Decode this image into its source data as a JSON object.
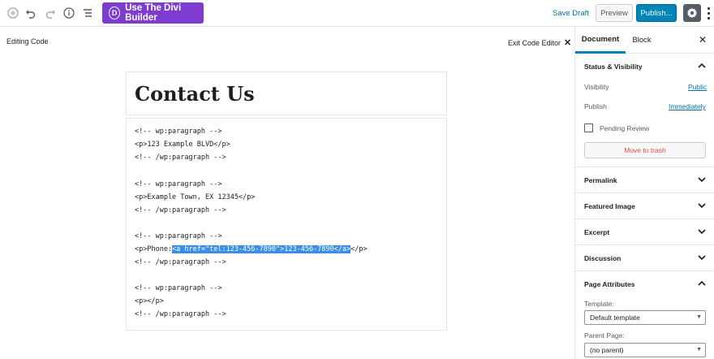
{
  "toolbar": {
    "divi_label": "Use The Divi Builder",
    "divi_logo": "D",
    "save_draft": "Save Draft",
    "preview": "Preview",
    "publish": "Publish..."
  },
  "editor": {
    "mode_label": "Editing Code",
    "exit_label": "Exit Code Editor",
    "title": "Contact Us",
    "code_lines": [
      "<!-- wp:paragraph -->",
      "<p>123 Example BLVD</p>",
      "<!-- /wp:paragraph -->",
      "",
      "<!-- wp:paragraph -->",
      "<p>Example Town, EX 12345</p>",
      "<!-- /wp:paragraph -->",
      "",
      "<!-- wp:paragraph -->",
      "<p>Phone:",
      "<!-- /wp:paragraph -->",
      "",
      "<!-- wp:paragraph -->",
      "<p></p>",
      "<!-- /wp:paragraph -->"
    ],
    "selected_text": "<a href=\"tel:123-456-7890\">123-456-7890</a>",
    "after_selection": "</p>"
  },
  "sidebar": {
    "tab_document": "Document",
    "tab_block": "Block",
    "status_title": "Status & Visibility",
    "visibility_label": "Visibility",
    "visibility_value": "Public",
    "publish_label": "Publish",
    "publish_value": "Immediately",
    "pending_review": "Pending Review",
    "move_to_trash": "Move to trash",
    "permalink": "Permalink",
    "featured_image": "Featured Image",
    "excerpt": "Excerpt",
    "discussion": "Discussion",
    "page_attributes": "Page Attributes",
    "template_label": "Template:",
    "template_value": "Default template",
    "parent_label": "Parent Page:",
    "parent_value": "(no parent)"
  },
  "colors": {
    "divi_purple": "#7e3bd0",
    "primary_blue": "#0085ba",
    "link_blue": "#0073aa",
    "trash_red": "#d94f4f",
    "selection_blue": "#3a8ee6"
  }
}
